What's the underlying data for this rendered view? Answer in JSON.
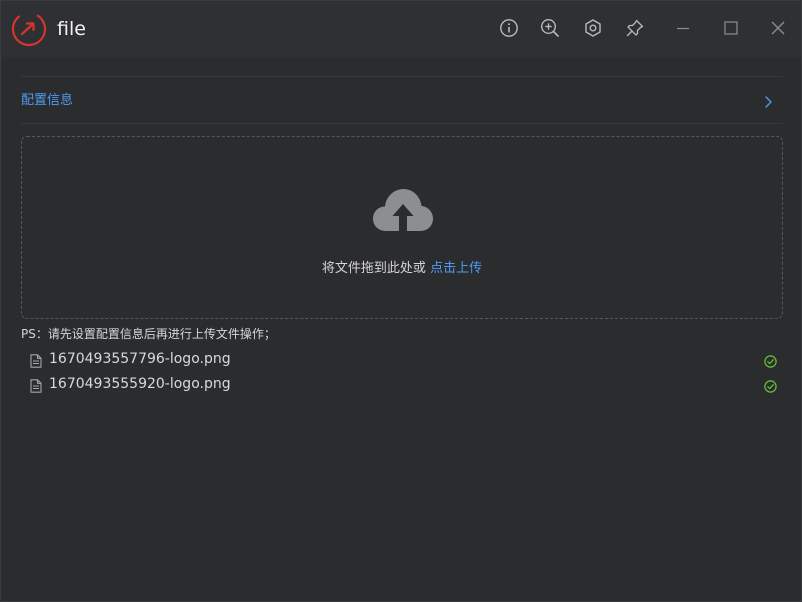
{
  "app": {
    "title": "file"
  },
  "titlebar": {
    "icons": [
      "info-icon",
      "zoom-in-icon",
      "settings-icon",
      "pin-icon",
      "minimize-icon",
      "maximize-icon",
      "close-icon"
    ]
  },
  "config": {
    "label": "配置信息"
  },
  "upload": {
    "prompt": "将文件拖到此处或 ",
    "link_label": "点击上传"
  },
  "tip": "PS：请先设置配置信息后再进行上传文件操作；",
  "files": [
    {
      "name": "1670493557796-logo.png",
      "status": "success"
    },
    {
      "name": "1670493555920-logo.png",
      "status": "success"
    }
  ],
  "colors": {
    "accent": "#4e9cf2",
    "logo": "#d9342b",
    "success": "#67c23a",
    "background": "#2b2c2e"
  }
}
